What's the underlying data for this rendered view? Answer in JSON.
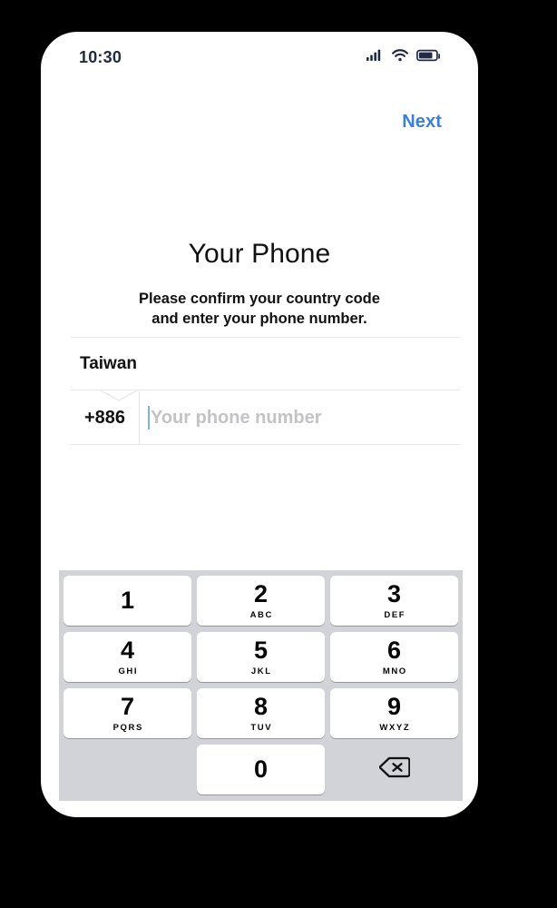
{
  "status_bar": {
    "time": "10:30",
    "icons": [
      "signal-icon",
      "wifi-icon",
      "battery-icon"
    ],
    "battery_level": 75,
    "icon_color": "#222b45"
  },
  "nav": {
    "next_label": "Next",
    "next_color": "#3b7fd9"
  },
  "main": {
    "title": "Your Phone",
    "subtitle_line1": "Please confirm your country code",
    "subtitle_line2": "and enter your phone number."
  },
  "form": {
    "country_name": "Taiwan",
    "country_code": "+886",
    "phone_placeholder": "Your phone number",
    "phone_value": "",
    "caret_color": "#7fb0ec",
    "divider_color": "#e8e8e8"
  },
  "keypad": {
    "background": "#d1d3d9",
    "key_background": "#ffffff",
    "rows": [
      [
        {
          "digit": "1",
          "letters": ""
        },
        {
          "digit": "2",
          "letters": "ABC"
        },
        {
          "digit": "3",
          "letters": "DEF"
        }
      ],
      [
        {
          "digit": "4",
          "letters": "GHI"
        },
        {
          "digit": "5",
          "letters": "JKL"
        },
        {
          "digit": "6",
          "letters": "MNO"
        }
      ],
      [
        {
          "digit": "7",
          "letters": "PQRS"
        },
        {
          "digit": "8",
          "letters": "TUV"
        },
        {
          "digit": "9",
          "letters": "WXYZ"
        }
      ]
    ],
    "last_row": {
      "zero": {
        "digit": "0",
        "letters": ""
      },
      "delete_icon": "backspace-delete-icon"
    }
  }
}
